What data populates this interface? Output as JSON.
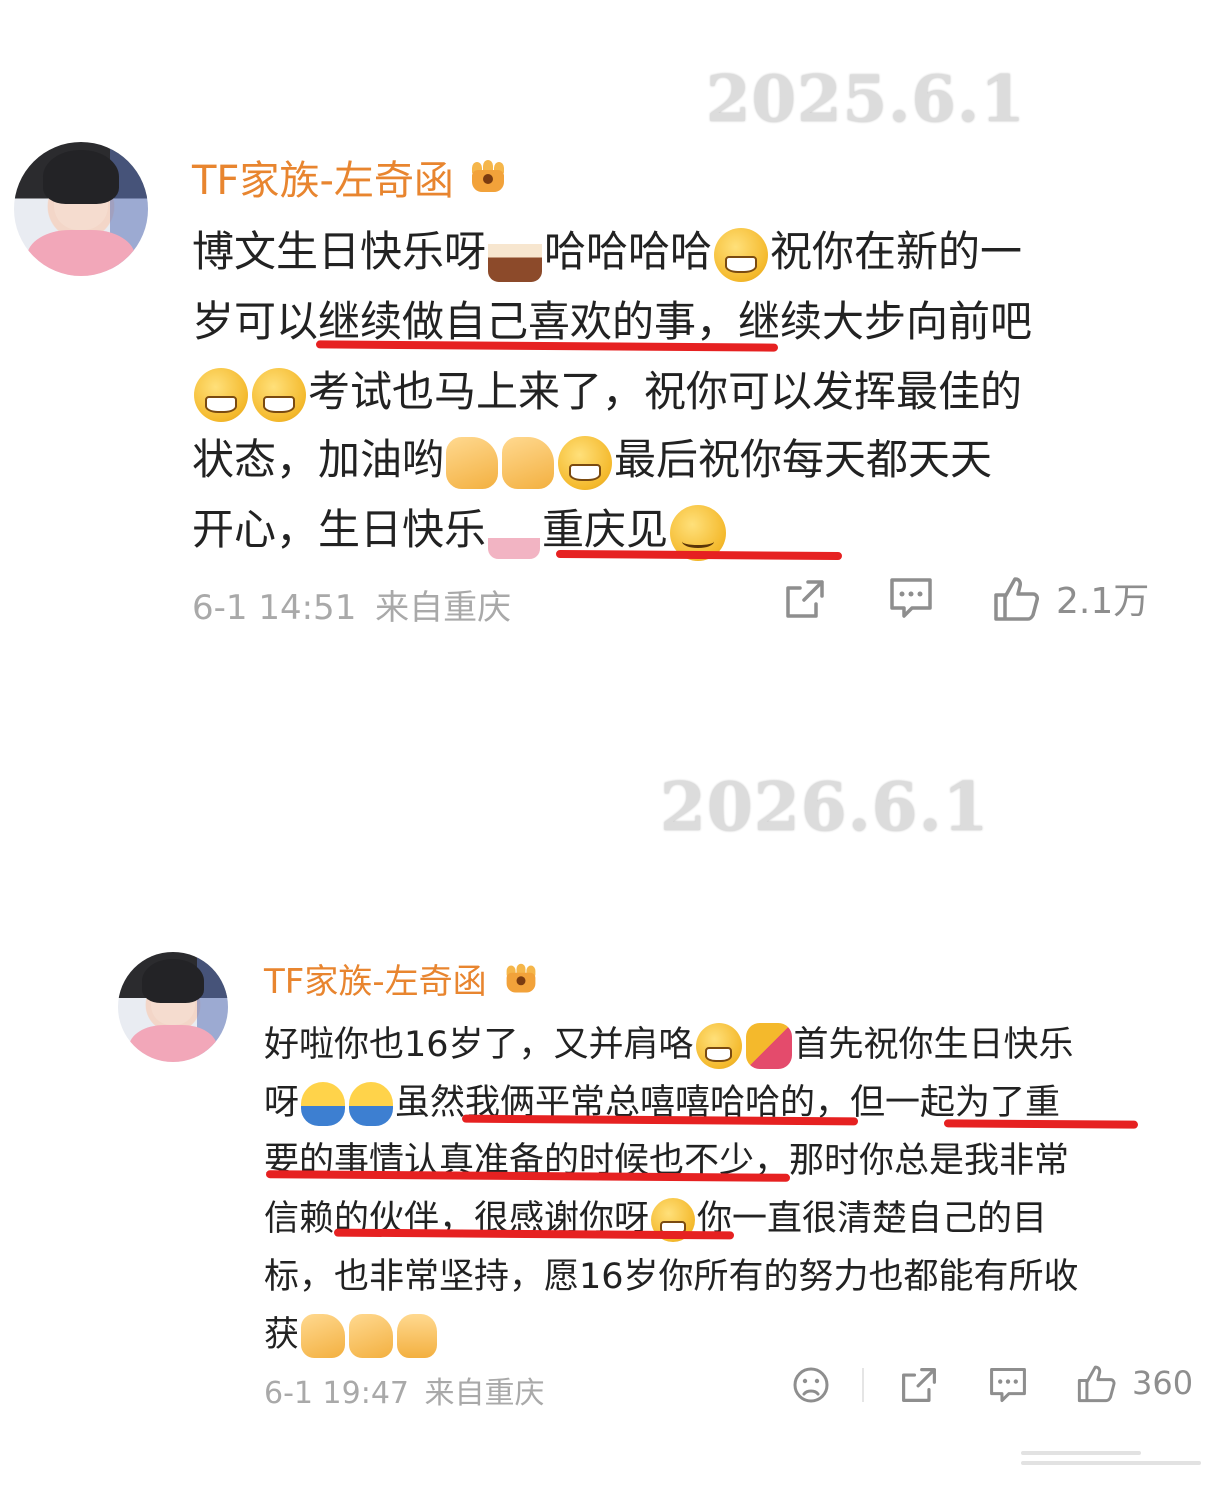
{
  "labels": {
    "year_1": "2025.6.1",
    "year_2": "2026.6.1"
  },
  "comment_1": {
    "username": "TF家族-左奇函",
    "lines": [
      [
        "博文生日快乐呀",
        "哈哈哈哈",
        "祝你在新的一"
      ],
      [
        "岁可以继续做自己喜欢的事，继续大步向前吧"
      ],
      [
        "考试也马上来了，祝你可以发挥最佳的"
      ],
      [
        "状态，加油哟",
        "最后祝你每天都天天"
      ],
      [
        "开心，生日快乐",
        "重庆见"
      ]
    ],
    "time": "6-1 14:51",
    "location": "来自重庆",
    "like_count": "2.1万"
  },
  "comment_2": {
    "username": "TF家族-左奇函",
    "lines": [
      [
        "好啦你也16岁了，又并肩咯",
        "首先祝你生日快乐"
      ],
      [
        "呀",
        "虽然我俩平常总嘻嘻哈哈的，但一起为了重"
      ],
      [
        "要的事情认真准备的时候也不少，那时你总是我非常"
      ],
      [
        "信赖的伙伴，很感谢你呀",
        "你一直很清楚自己的目"
      ],
      [
        "标，也非常坚持，愿16岁你所有的努力也都能有所收"
      ],
      [
        "获"
      ]
    ],
    "time": "6-1 19:47",
    "location": "来自重庆",
    "like_count": "360"
  },
  "icons": {
    "share": "share-icon",
    "comment": "comment-icon",
    "like": "thumbs-up-icon",
    "dislike": "sad-face-icon"
  },
  "colors": {
    "username": "#e8852f",
    "highlight": "#e62121",
    "meta": "#a9a9a9"
  }
}
